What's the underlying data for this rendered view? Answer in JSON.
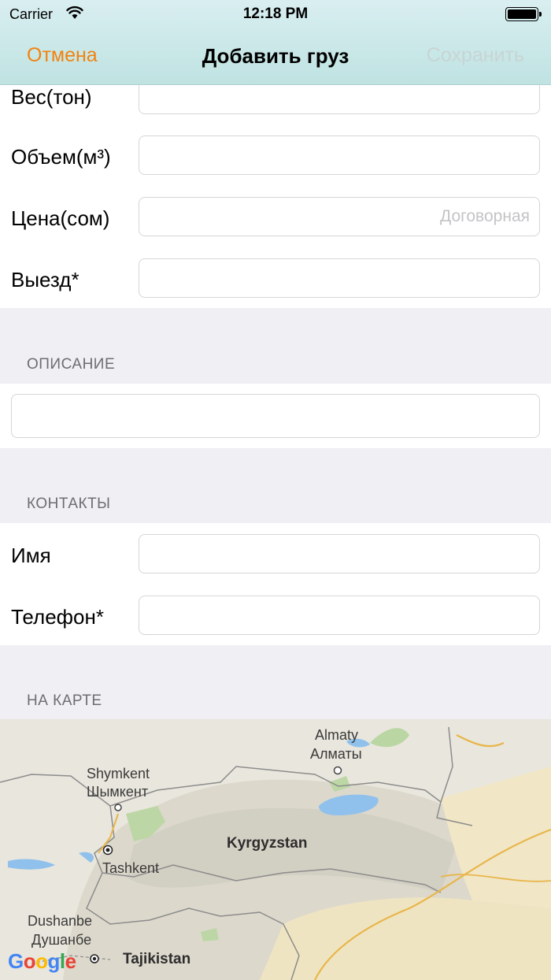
{
  "status_bar": {
    "carrier": "Carrier",
    "time": "12:18 PM"
  },
  "nav": {
    "cancel": "Отмена",
    "title": "Добавить груз",
    "save": "Сохранить"
  },
  "cargo": {
    "weight_label": "Вес(тон)",
    "volume_label": "Объем(м³)",
    "price_label": "Цена(сом)",
    "price_placeholder": "Договорная",
    "departure_label": "Выезд*"
  },
  "description": {
    "header": "ОПИСАНИЕ"
  },
  "contacts": {
    "header": "КОНТАКТЫ",
    "name_label": "Имя",
    "phone_label": "Телефон*"
  },
  "map": {
    "header": "НА КАРТЕ",
    "labels": {
      "almaty_en": "Almaty",
      "almaty_ru": "Алматы",
      "shymkent_en": "Shymkent",
      "shymkent_ru": "Шымкент",
      "kyrgyzstan": "Kyrgyzstan",
      "tashkent": "Tashkent",
      "dushanbe_en": "Dushanbe",
      "dushanbe_ru": "Душанбе",
      "tajikistan": "Tajikistan"
    },
    "logo": "Google"
  },
  "colors": {
    "accent": "#f3820f",
    "disabled": "#c8d4d4",
    "nav_bg": "#c9e8e7",
    "group_bg": "#efeff4"
  }
}
